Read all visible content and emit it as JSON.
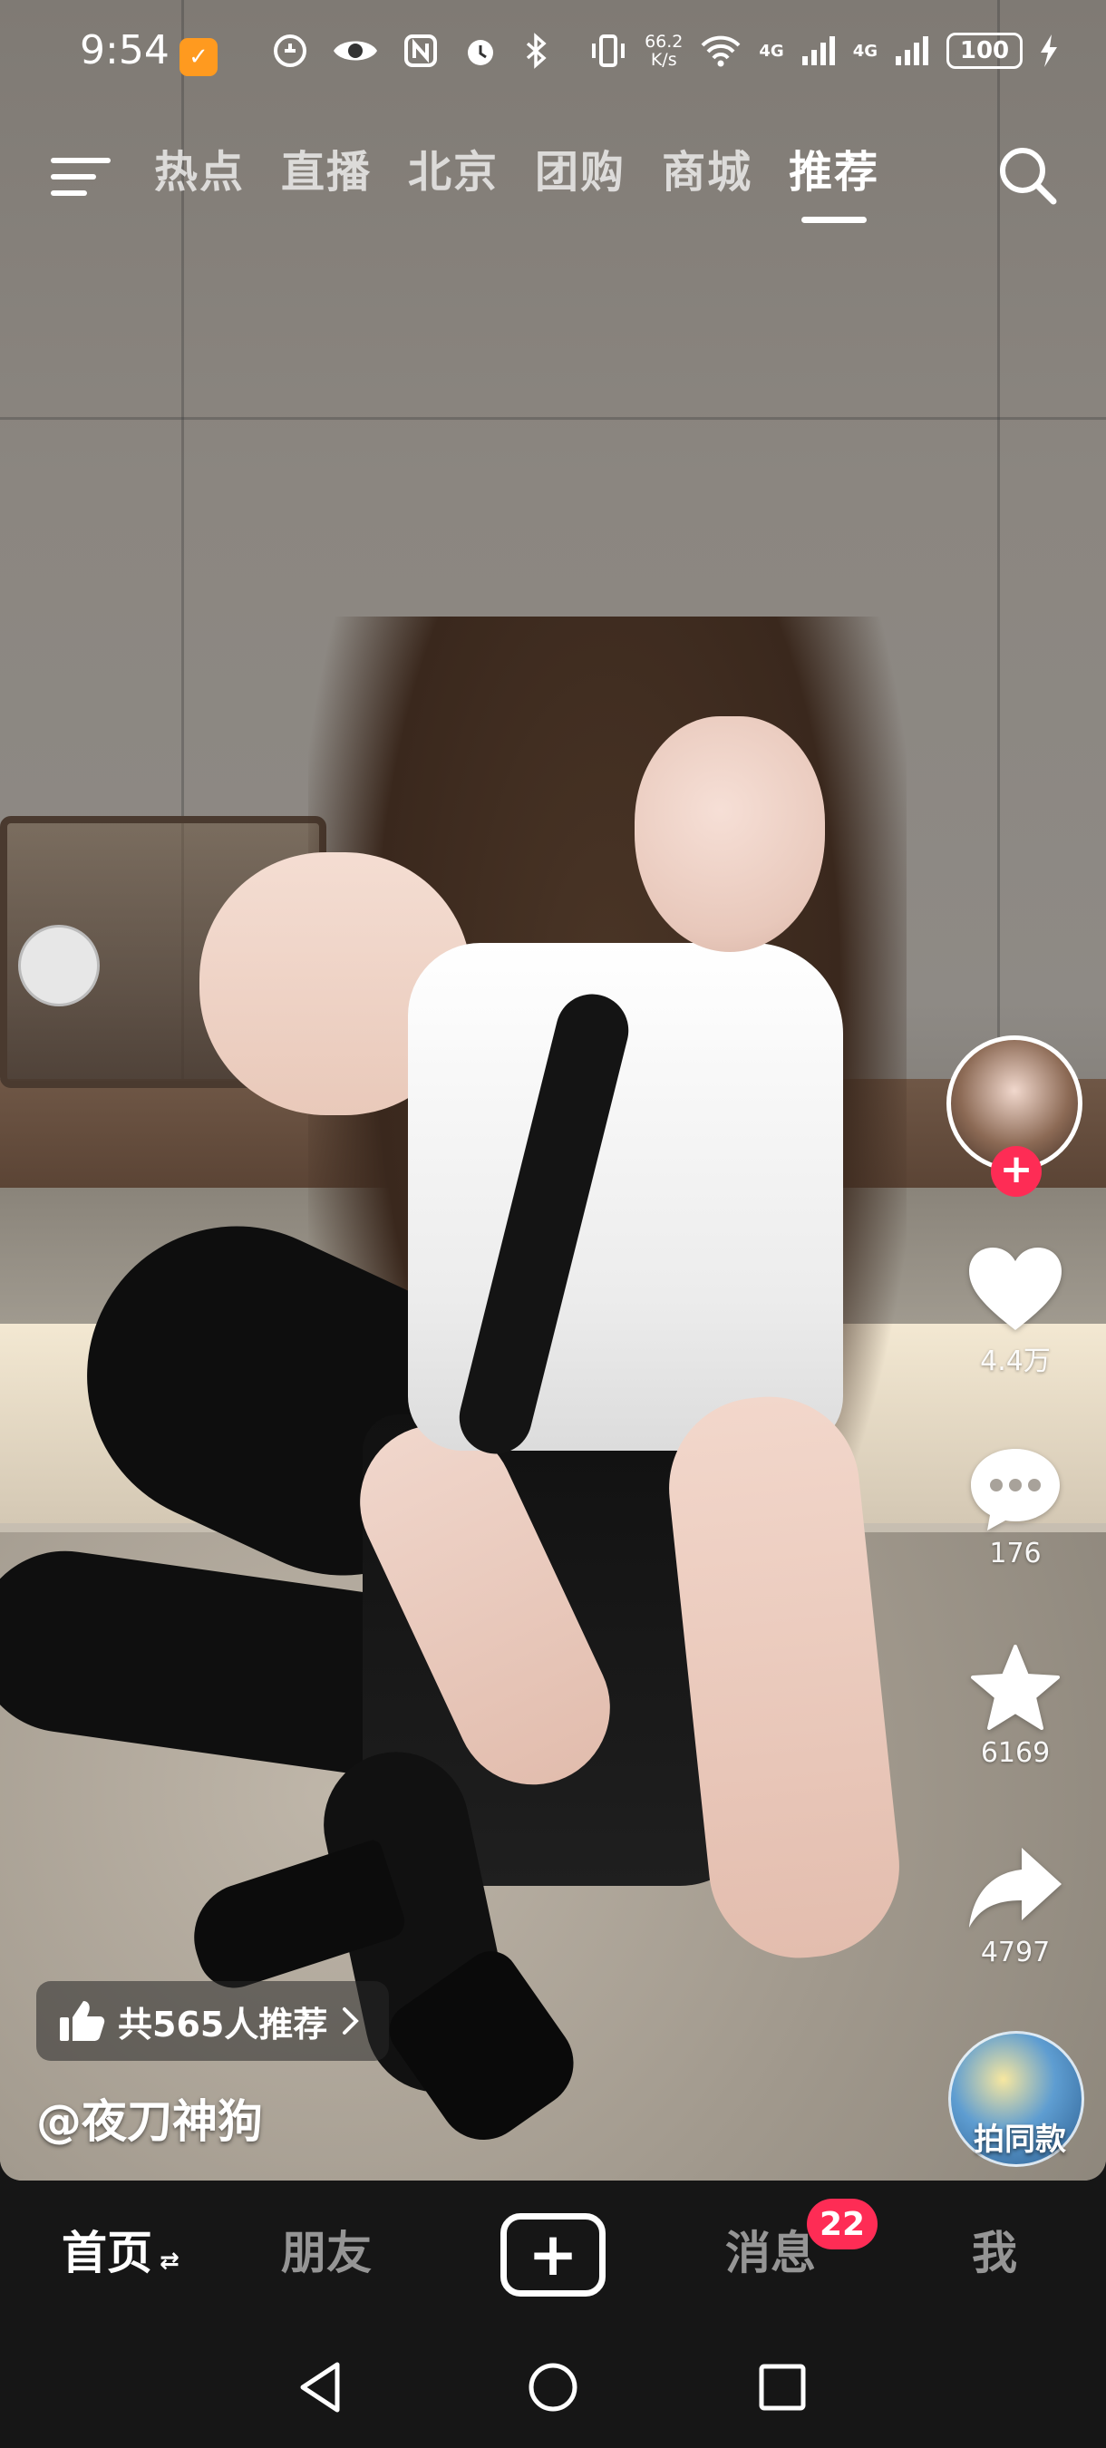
{
  "status_bar": {
    "time": "9:54",
    "net_speed_top": "66.2",
    "net_speed_bottom": "K/s",
    "signal1": "4G",
    "signal2": "4G",
    "battery": "100"
  },
  "top_nav": {
    "tabs": [
      {
        "label": "热点"
      },
      {
        "label": "直播"
      },
      {
        "label": "北京"
      },
      {
        "label": "团购"
      },
      {
        "label": "商城"
      },
      {
        "label": "推荐",
        "active": true
      }
    ]
  },
  "actions": {
    "likes": "4.4万",
    "comments": "176",
    "favorites": "6169",
    "shares": "4797",
    "same_style": "拍同款"
  },
  "video_info": {
    "recommend_text": "共565人推荐",
    "author": "@夜刀神狗"
  },
  "bottom_tabs": {
    "home": "首页",
    "friends": "朋友",
    "publish": "+",
    "messages": "消息",
    "messages_badge": "22",
    "me": "我"
  },
  "colors": {
    "accent": "#fe2c55",
    "bar_bg": "#161616"
  }
}
